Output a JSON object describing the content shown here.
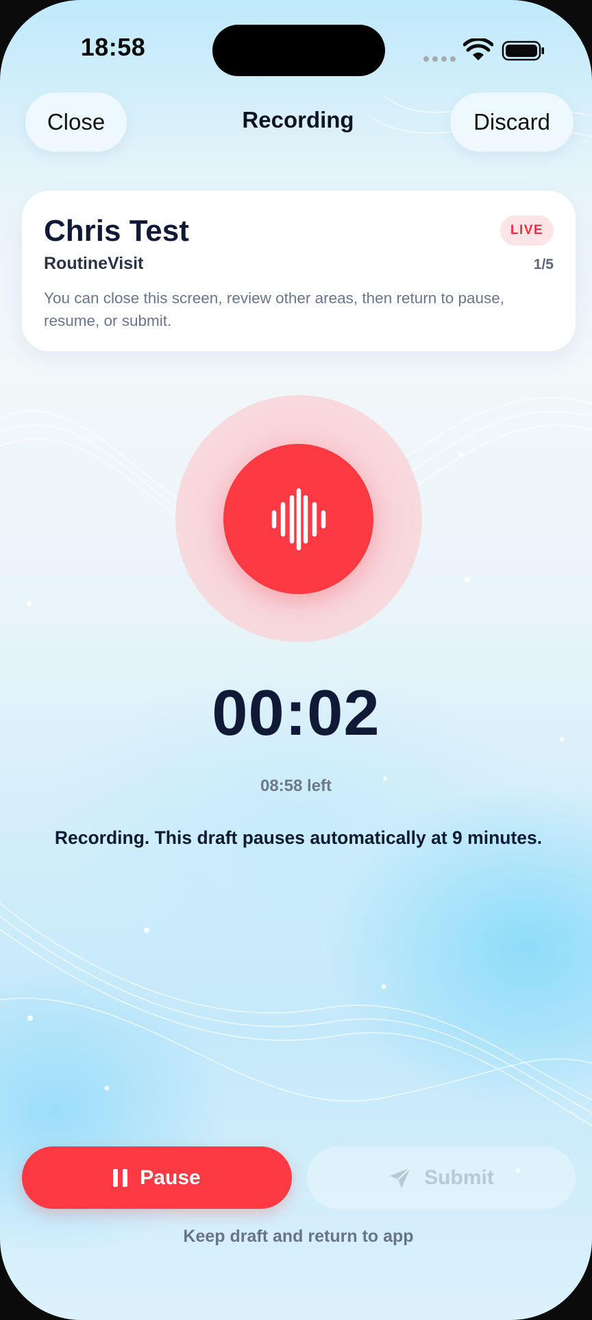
{
  "status_bar": {
    "time": "18:58"
  },
  "header": {
    "close_label": "Close",
    "title": "Recording",
    "discard_label": "Discard"
  },
  "card": {
    "name": "Chris Test",
    "visit_type": "RoutineVisit",
    "badge": "LIVE",
    "count": "1/5",
    "hint": "You can close this screen, review other areas, then return to pause, resume, or submit."
  },
  "recorder": {
    "elapsed": "00:02",
    "remaining": "08:58 left",
    "message": "Recording. This draft pauses automatically at 9 minutes."
  },
  "actions": {
    "pause_label": "Pause",
    "submit_label": "Submit",
    "keep_draft_label": "Keep draft and return to app"
  },
  "colors": {
    "accent_red": "#fd3a43",
    "text_dark": "#101a36",
    "live_badge_bg": "#fde4e6"
  },
  "icons": [
    "wifi-icon",
    "battery-icon",
    "waveform-icon",
    "pause-icon",
    "paper-plane-icon"
  ]
}
